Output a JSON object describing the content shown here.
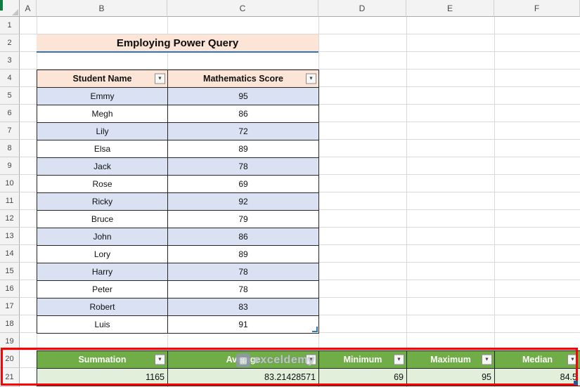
{
  "colors": {
    "title_bg": "#FCE4D6",
    "title_underline": "#2E75B6",
    "table_header_bg": "#FCE4D6",
    "row_alt_bg": "#D9E1F2",
    "summary_header_bg": "#70AD47",
    "summary_value_bg": "#E2EFDA",
    "highlight_border": "#FF0000"
  },
  "sheet": {
    "col_headers": [
      "A",
      "B",
      "C",
      "D",
      "E",
      "F"
    ],
    "row_headers": [
      "1",
      "2",
      "3",
      "4",
      "5",
      "6",
      "7",
      "8",
      "9",
      "10",
      "11",
      "12",
      "13",
      "14",
      "15",
      "16",
      "17",
      "18",
      "19",
      "20",
      "21"
    ]
  },
  "title": "Employing Power Query",
  "student_table": {
    "name_header": "Student Name",
    "score_header": "Mathematics Score",
    "rows": [
      [
        "Emmy",
        "95"
      ],
      [
        "Megh",
        "86"
      ],
      [
        "Lily",
        "72"
      ],
      [
        "Elsa",
        "89"
      ],
      [
        "Jack",
        "78"
      ],
      [
        "Rose",
        "69"
      ],
      [
        "Ricky",
        "92"
      ],
      [
        "Bruce",
        "79"
      ],
      [
        "John",
        "86"
      ],
      [
        "Lory",
        "89"
      ],
      [
        "Harry",
        "78"
      ],
      [
        "Peter",
        "78"
      ],
      [
        "Robert",
        "83"
      ],
      [
        "Luis",
        "91"
      ]
    ]
  },
  "summary_table": {
    "headers": [
      "Summation",
      "Average",
      "Minimum",
      "Maximum",
      "Median"
    ],
    "values": [
      "1165",
      "83.21428571",
      "69",
      "95",
      "84.5"
    ]
  },
  "watermark": {
    "text": "exceldemy",
    "logo_glyph": "▦"
  },
  "icons": {
    "filter": "▼"
  }
}
